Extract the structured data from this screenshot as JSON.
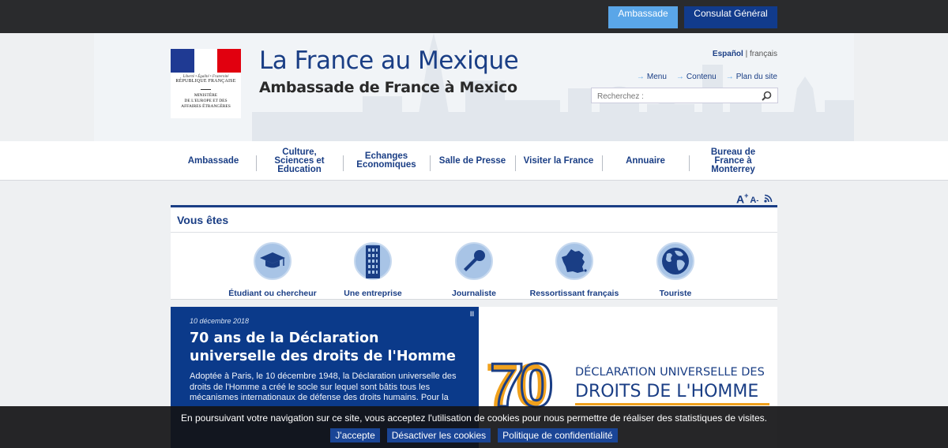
{
  "topbar": {
    "tab_ambassade": "Ambassade",
    "tab_consulat": "Consulat Général",
    "colors": {
      "ambassade": "#5aa6e8",
      "consulat": "#113b8c"
    }
  },
  "header": {
    "logo": {
      "motto": "Liberté • Égalité • Fraternité",
      "republique": "RÉPUBLIQUE FRANÇAISE",
      "ministry_line1": "MINISTÈRE",
      "ministry_line2": "DE L'EUROPE ET DES",
      "ministry_line3": "AFFAIRES ÉTRANGÈRES"
    },
    "title": "La France au Mexique",
    "subtitle": "Ambassade de France à Mexico",
    "lang_es": "Español",
    "lang_sep": " | ",
    "lang_fr": "français",
    "quicklinks": [
      "Menu",
      "Contenu",
      "Plan du site"
    ],
    "search_placeholder": "Recherchez :",
    "brand_color": "#1a3e85"
  },
  "mainnav": {
    "items": [
      "Ambassade",
      "Culture, Sciences et Education",
      "Echanges Economiques",
      "Salle de Presse",
      "Visiter la France",
      "Annuaire",
      "Bureau de France à Monterrey"
    ]
  },
  "tools": {
    "font_large": "A",
    "font_plus": "+",
    "font_small": "A",
    "font_minus": "-",
    "rss_icon": "rss-icon"
  },
  "profiles": {
    "title": "Vous êtes",
    "items": [
      {
        "label": "Étudiant ou chercheur",
        "icon": "graduation-cap-icon"
      },
      {
        "label": "Une entreprise",
        "icon": "building-icon"
      },
      {
        "label": "Journaliste",
        "icon": "microphone-icon"
      },
      {
        "label": "Ressortissant français",
        "icon": "france-map-icon"
      },
      {
        "label": "Touriste",
        "icon": "globe-icon"
      }
    ]
  },
  "slide": {
    "date": "10 décembre 2018",
    "title": "70 ans de la Déclaration universelle des droits de l'Homme",
    "body": "Adoptée à Paris, le 10 décembre 1948, la Déclaration universelle des droits de l'Homme a créé le socle sur lequel sont bâtis tous les mécanismes internationaux de défense des droits humains. Pour la",
    "pause": "II",
    "image": {
      "number": "70",
      "line1": "DÉCLARATION UNIVERSELLE DES",
      "line2": "DROITS DE L'HOMME"
    }
  },
  "cookie": {
    "message": "En poursuivant votre navigation sur ce site, vous acceptez l'utilisation de cookies pour nous permettre de réaliser des statistiques de visites.",
    "accept": "J'accepte",
    "disable": "Désactiver les cookies",
    "policy": "Politique de confidentialité"
  }
}
